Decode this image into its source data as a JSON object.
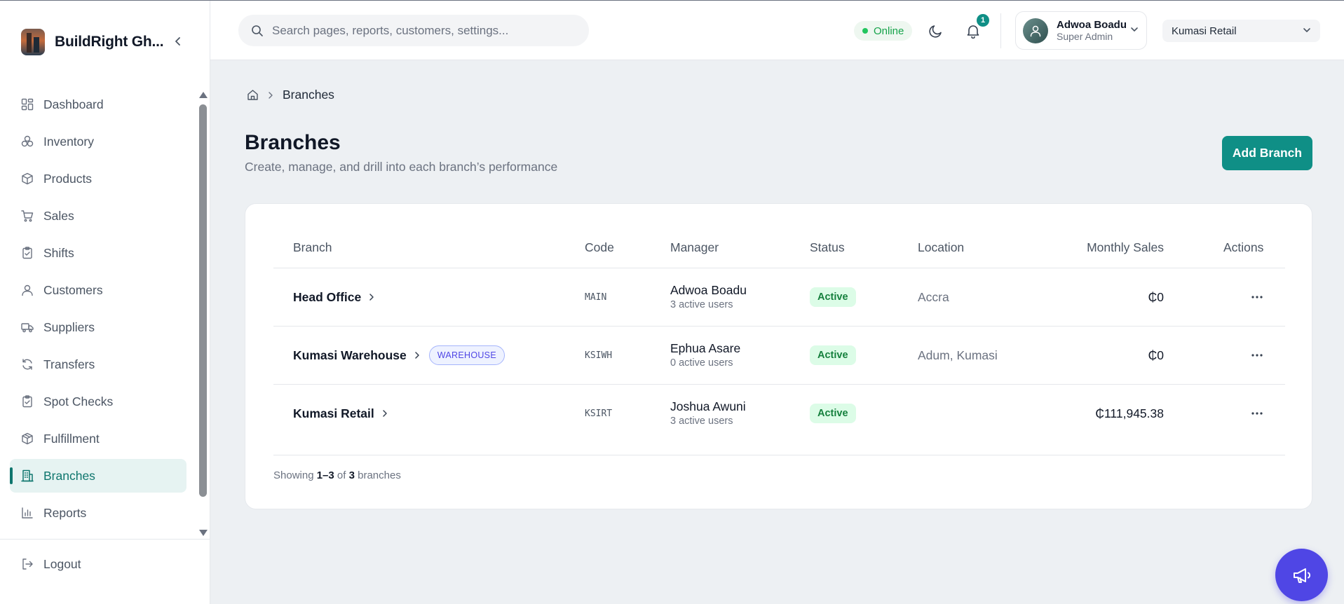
{
  "brand": {
    "name": "BuildRight Gh..."
  },
  "sidebar": {
    "items": [
      {
        "label": "Dashboard",
        "icon": "dashboard-icon"
      },
      {
        "label": "Inventory",
        "icon": "inventory-icon"
      },
      {
        "label": "Products",
        "icon": "box-icon"
      },
      {
        "label": "Sales",
        "icon": "cart-icon"
      },
      {
        "label": "Shifts",
        "icon": "clipboard-check-icon"
      },
      {
        "label": "Customers",
        "icon": "user-icon"
      },
      {
        "label": "Suppliers",
        "icon": "truck-icon"
      },
      {
        "label": "Transfers",
        "icon": "refresh-icon"
      },
      {
        "label": "Spot Checks",
        "icon": "clipboard-check-icon"
      },
      {
        "label": "Fulfillment",
        "icon": "package-icon"
      },
      {
        "label": "Branches",
        "icon": "building-icon",
        "active": true
      },
      {
        "label": "Reports",
        "icon": "bar-chart-icon"
      }
    ],
    "logout_label": "Logout"
  },
  "header": {
    "search_placeholder": "Search pages, reports, customers, settings...",
    "status": "Online",
    "notifications_count": "1",
    "user": {
      "name": "Adwoa Boadu",
      "role": "Super Admin"
    },
    "branch_selected": "Kumasi Retail"
  },
  "breadcrumb": {
    "current": "Branches"
  },
  "page": {
    "title": "Branches",
    "subtitle": "Create, manage, and drill into each branch’s performance",
    "add_button": "Add Branch"
  },
  "table": {
    "columns": [
      "Branch",
      "Code",
      "Manager",
      "Status",
      "Location",
      "Monthly Sales",
      "Actions"
    ],
    "rows": [
      {
        "branch": "Head Office",
        "badge": "",
        "code": "MAIN",
        "manager": "Adwoa Boadu",
        "users": "3 active users",
        "status": "Active",
        "location": "Accra",
        "sales": "₵0"
      },
      {
        "branch": "Kumasi Warehouse",
        "badge": "WAREHOUSE",
        "code": "KSIWH",
        "manager": "Ephua Asare",
        "users": "0 active users",
        "status": "Active",
        "location": "Adum, Kumasi",
        "sales": "₵0"
      },
      {
        "branch": "Kumasi Retail",
        "badge": "",
        "code": "KSIRT",
        "manager": "Joshua Awuni",
        "users": "3 active users",
        "status": "Active",
        "location": "",
        "sales": "₵111,945.38"
      }
    ],
    "footer": {
      "prefix": "Showing",
      "range": "1–3",
      "of": "of",
      "total": "3",
      "suffix": "branches"
    }
  },
  "colors": {
    "accent": "#0f8f86",
    "active_nav": "#0f766e",
    "fab": "#4f46e5",
    "status_green": "#15803d"
  }
}
